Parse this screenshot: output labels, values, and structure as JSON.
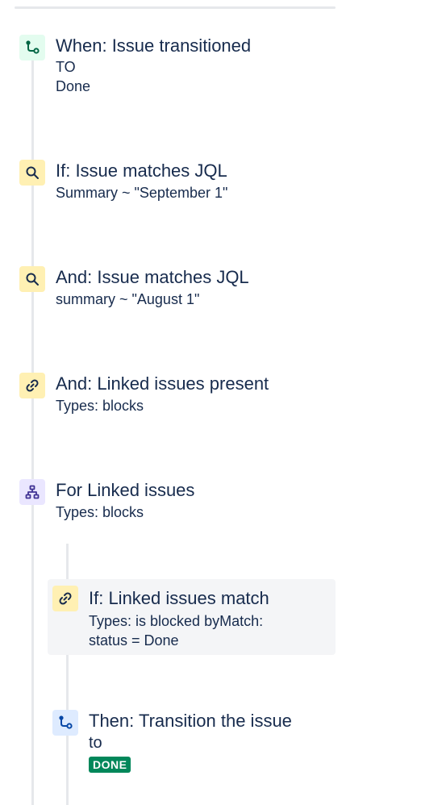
{
  "rule_components": [
    {
      "id": "trigger",
      "icon": "transition-icon",
      "color": "#e3fcef",
      "title": "When: Issue transitioned",
      "line1": "TO",
      "line2": "Done"
    },
    {
      "id": "cond1",
      "icon": "search-icon",
      "color": "#fff0b3",
      "title": "If: Issue matches JQL",
      "detail": "Summary ~ \"September 1\""
    },
    {
      "id": "cond2",
      "icon": "search-icon",
      "color": "#fff0b3",
      "title": "And: Issue matches JQL",
      "detail": "summary ~ \"August 1\""
    },
    {
      "id": "cond3",
      "icon": "link-icon",
      "color": "#fff0b3",
      "title": "And: Linked issues present",
      "detail": "Types: blocks"
    },
    {
      "id": "branch",
      "icon": "branch-hierarchy-icon",
      "color": "#eae6ff",
      "title": "For Linked issues",
      "detail": "Types: blocks"
    },
    {
      "id": "nested-cond",
      "icon": "link-icon",
      "color": "#fff0b3",
      "title": "If: Linked issues match",
      "line1": "Types: is blocked byMatch:",
      "line2": "status = Done"
    },
    {
      "id": "nested-action",
      "icon": "transition-icon",
      "color": "#deebff",
      "title": "Then: Transition the issue",
      "line1": "to",
      "status": "DONE",
      "status_color": "#00875a"
    }
  ]
}
